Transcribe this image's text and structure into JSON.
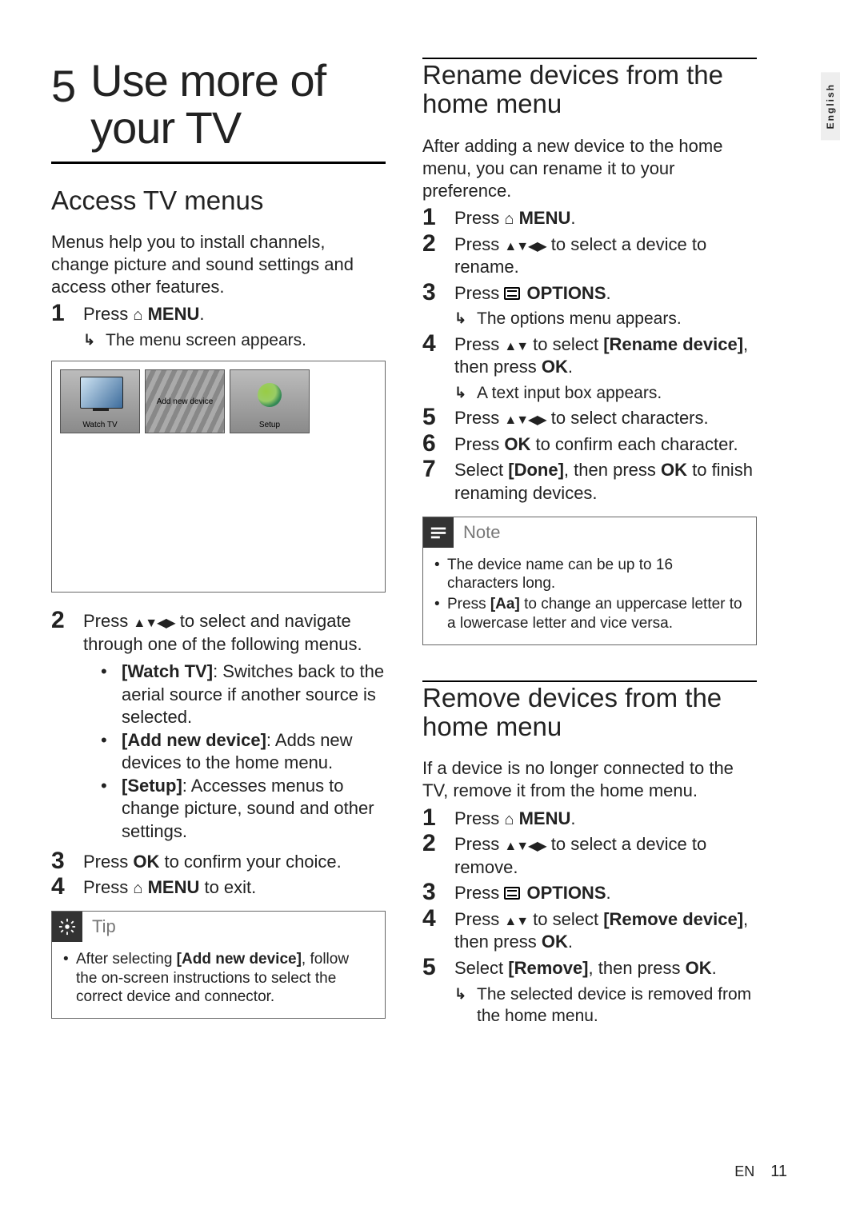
{
  "language_tab": "English",
  "chapter": {
    "number": "5",
    "title": "Use more of your TV"
  },
  "left": {
    "section1": {
      "title": "Access TV menus",
      "intro": "Menus help you to install channels, change picture and sound settings and access other features.",
      "step1": {
        "num": "1",
        "text_pre": "Press ",
        "menu": "MENU",
        "period": "."
      },
      "step1_result": "The menu screen appears.",
      "tiles": {
        "watch": "Watch TV",
        "add": "Add new device",
        "setup": "Setup"
      },
      "step2": {
        "num": "2",
        "text_pre": "Press ",
        "text_post": " to select and navigate through one of the following menus."
      },
      "bullets": [
        {
          "label": "[Watch TV]",
          "text": ": Switches back to the aerial source if another source is selected."
        },
        {
          "label": "[Add new device]",
          "text": ": Adds new devices to the home menu."
        },
        {
          "label": "[Setup]",
          "text": ": Accesses menus to change picture, sound and other settings."
        }
      ],
      "step3": {
        "num": "3",
        "text_pre": "Press ",
        "ok": "OK",
        "text_post": " to confirm your choice."
      },
      "step4": {
        "num": "4",
        "text_pre": "Press ",
        "menu": "MENU",
        "text_post": " to exit."
      }
    },
    "tip": {
      "label": "Tip",
      "items": [
        "After selecting [Add new device], follow the on-screen instructions to select the correct device and connector."
      ],
      "bold_in_item0": "[Add new device]"
    }
  },
  "right": {
    "section2": {
      "title": "Rename devices from the home menu",
      "intro": "After adding a new device to the home menu, you can rename it to your preference.",
      "steps": {
        "s1": {
          "num": "1",
          "pre": "Press ",
          "menu": "MENU",
          "post": "."
        },
        "s2": {
          "num": "2",
          "pre": "Press ",
          "post": " to select a device to rename."
        },
        "s3": {
          "num": "3",
          "pre": "Press ",
          "opt": "OPTIONS",
          "post": "."
        },
        "s3_result": "The options menu appears.",
        "s4": {
          "num": "4",
          "pre": "Press ",
          "mid": " to select ",
          "label": "[Rename device]",
          "then": ", then press ",
          "ok": "OK",
          "post": "."
        },
        "s4_result": "A text input box appears.",
        "s5": {
          "num": "5",
          "pre": "Press ",
          "post": " to select characters."
        },
        "s6": {
          "num": "6",
          "pre": "Press ",
          "ok": "OK",
          "post": " to confirm each character."
        },
        "s7": {
          "num": "7",
          "pre": "Select ",
          "label": "[Done]",
          "then": ", then press ",
          "ok": "OK",
          "post": " to finish renaming devices."
        }
      }
    },
    "note": {
      "label": "Note",
      "items": [
        "The device name can be up to 16 characters long.",
        "Press [Aa] to change an uppercase letter to a lowercase letter and vice versa."
      ],
      "bold_in_item1": "[Aa]"
    },
    "section3": {
      "title": "Remove devices from the home menu",
      "intro": "If a device is no longer connected to the TV, remove it from the home menu.",
      "steps": {
        "s1": {
          "num": "1",
          "pre": "Press ",
          "menu": "MENU",
          "post": "."
        },
        "s2": {
          "num": "2",
          "pre": "Press ",
          "post": " to select a device to remove."
        },
        "s3": {
          "num": "3",
          "pre": "Press ",
          "opt": "OPTIONS",
          "post": "."
        },
        "s4": {
          "num": "4",
          "pre": "Press ",
          "mid": " to select ",
          "label": "[Remove device]",
          "then": ", then press ",
          "ok": "OK",
          "post": "."
        },
        "s5": {
          "num": "5",
          "pre": "Select ",
          "label": "[Remove]",
          "then": ", then press ",
          "ok": "OK",
          "post": "."
        },
        "s5_result": "The selected device is removed from the home menu."
      }
    }
  },
  "footer": {
    "lang": "EN",
    "page": "11"
  }
}
